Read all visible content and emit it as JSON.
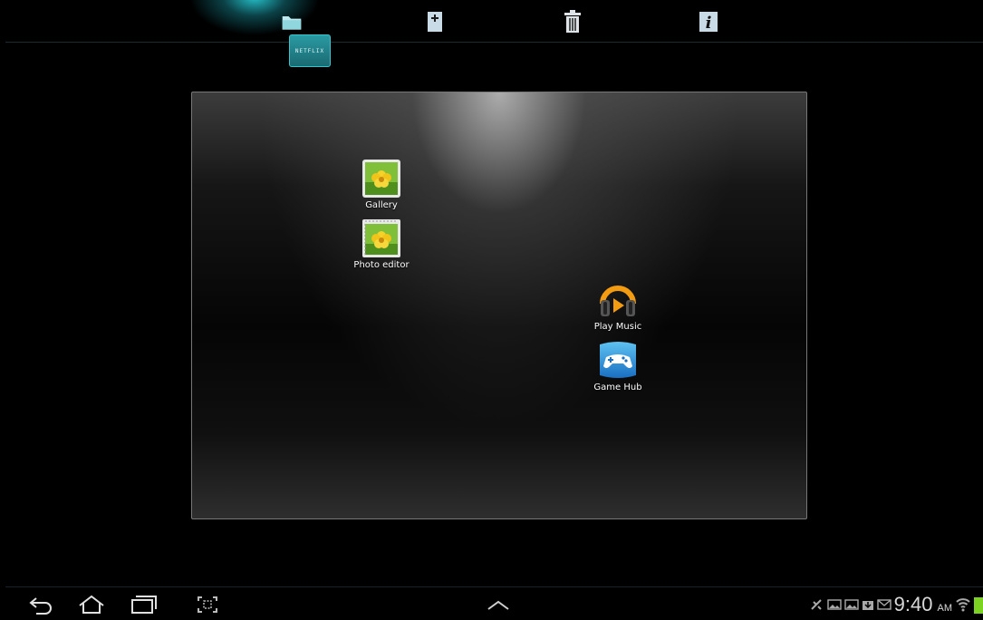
{
  "top_bar": {
    "buttons": [
      {
        "id": "folder",
        "icon": "folder-icon"
      },
      {
        "id": "add",
        "icon": "add-page-icon"
      },
      {
        "id": "delete",
        "icon": "trash-icon"
      },
      {
        "id": "info",
        "icon": "info-icon",
        "glyph": "i"
      }
    ],
    "drag_item_label": "NETFLIX"
  },
  "folder": {
    "apps": [
      {
        "label": "Gallery",
        "icon": "gallery-icon"
      },
      {
        "label": "Photo editor",
        "icon": "photo-editor-icon"
      },
      {
        "label": "Play Music",
        "icon": "play-music-icon"
      },
      {
        "label": "Game Hub",
        "icon": "game-hub-icon"
      }
    ]
  },
  "nav_bar": {
    "buttons": [
      "back-icon",
      "home-icon",
      "recent-apps-icon",
      "screenshot-icon",
      "up-arrow-icon"
    ],
    "status": {
      "time": "9:40",
      "ampm": "AM",
      "icons": [
        "usb-debug-icon",
        "image-icon",
        "image-icon",
        "download-icon",
        "mail-icon",
        "wifi-icon",
        "battery-icon"
      ]
    }
  },
  "colors": {
    "accent_teal": "#28c8d2",
    "background": "#000000",
    "battery": "#7dd321"
  }
}
